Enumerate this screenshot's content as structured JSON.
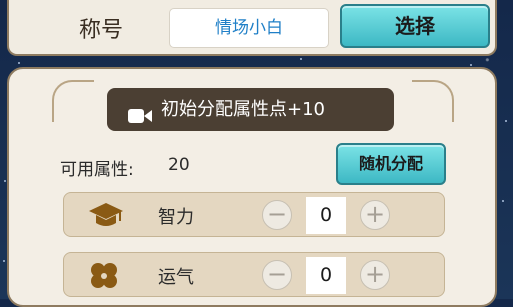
{
  "header": {
    "label": "称号",
    "current_title": "情场小白",
    "select_button": "选择"
  },
  "panel": {
    "video_button": "初始分配属性点+10",
    "available_label": "可用属性:",
    "available_value": "20",
    "random_button": "随机分配",
    "attributes": [
      {
        "name": "智力",
        "value": "0",
        "icon": "graduation-cap-icon"
      },
      {
        "name": "运气",
        "value": "0",
        "icon": "clover-icon"
      }
    ]
  },
  "controls": {
    "minus_symbol": "−",
    "plus_symbol": "+"
  },
  "colors": {
    "accent_button": "#3db8c4",
    "panel_bg": "#f3eee5",
    "title_text": "#1f7fc7",
    "icon_brown": "#8a5a14"
  }
}
